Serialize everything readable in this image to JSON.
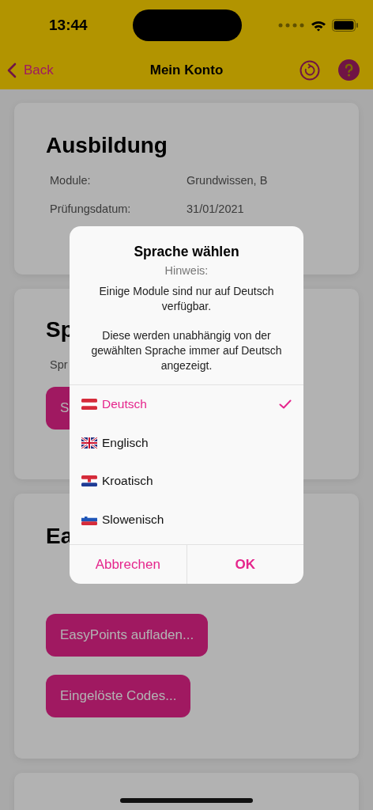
{
  "status_bar": {
    "time": "13:44"
  },
  "nav": {
    "back": "Back",
    "title": "Mein Konto"
  },
  "cards": [
    {
      "title": "Ausbildung",
      "rows": [
        {
          "label": "Module:",
          "value": "Grundwissen, B"
        },
        {
          "label": "Prüfungsdatum:",
          "value": "31/01/2021"
        }
      ]
    },
    {
      "title": "Sp",
      "rows": [
        {
          "label": "Spr"
        }
      ],
      "buttons": [
        "S"
      ]
    },
    {
      "title": "Ea",
      "buttons": [
        "EasyPoints aufladen...",
        "Eingelöste Codes..."
      ]
    }
  ],
  "dialog": {
    "title": "Sprache wählen",
    "subtitle": "Hinweis:",
    "message": [
      "Einige Module sind nur auf Deutsch verfügbar.",
      "Diese werden unabhängig von der gewählten Sprache immer auf Deutsch angezeigt."
    ],
    "options": [
      {
        "label": "Deutsch",
        "selected": true
      },
      {
        "label": "Englisch",
        "selected": false
      },
      {
        "label": "Kroatisch",
        "selected": false
      },
      {
        "label": "Slowenisch",
        "selected": false
      }
    ],
    "cancel": "Abbrechen",
    "ok": "OK"
  }
}
